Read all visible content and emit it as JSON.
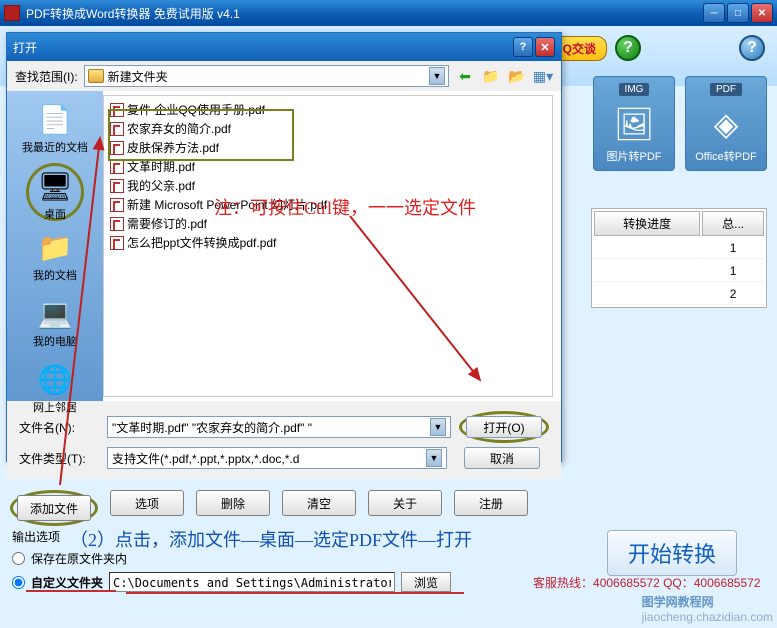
{
  "titlebar": {
    "title": "PDF转换成Word转换器 免费试用版 v4.1"
  },
  "header": {
    "qq_label": "QQ交谈"
  },
  "tiles": [
    {
      "badge": "IMG",
      "name": "图片转PDF"
    },
    {
      "badge": "PDF",
      "name": "Office转PDF"
    }
  ],
  "progress": {
    "col1": "转换进度",
    "col2": "总...",
    "rows": [
      "1",
      "1",
      "2"
    ]
  },
  "open_dialog": {
    "title": "打开",
    "lookin_label": "查找范围(I):",
    "lookin_value": "新建文件夹",
    "places": [
      "我最近的文档",
      "桌面",
      "我的文档",
      "我的电脑",
      "网上邻居"
    ],
    "files": [
      "复件 企业QQ使用手册.pdf",
      "农家弃女的简介.pdf",
      "皮肤保养方法.pdf",
      "文革时期.pdf",
      "我的父亲.pdf",
      "新建 Microsoft PowerPoint 幻灯片.pdf",
      "需要修订的.pdf",
      "怎么把ppt文件转换成pdf.pdf"
    ],
    "annotation": "注：可按住Ctrl键，一一选定文件",
    "filename_label": "文件名(N):",
    "filename_value": "\"文革时期.pdf\" \"农家弃女的简介.pdf\" \"",
    "filetype_label": "文件类型(T):",
    "filetype_value": "支持文件(*.pdf,*.ppt,*.pptx,*.doc,*.d",
    "open_btn": "打开(O)",
    "cancel_btn": "取消"
  },
  "buttons": {
    "add": "添加文件",
    "options": "选项",
    "delete": "删除",
    "clear": "清空",
    "about": "关于",
    "register": "注册"
  },
  "output": {
    "legend": "输出选项",
    "step": "（2）点击，添加文件—桌面—选定PDF文件—打开",
    "radio_same": "保存在原文件夹内",
    "radio_custom": "自定义文件夹",
    "path": "C:\\Documents and Settings\\Administrator\\桌面",
    "browse": "浏览",
    "hotline": "客服热线：4006685572 QQ：4006685572"
  },
  "start_btn": "开始转换",
  "watermark": "图学网教程网",
  "watermark2": "jiaocheng.chazidian.com"
}
